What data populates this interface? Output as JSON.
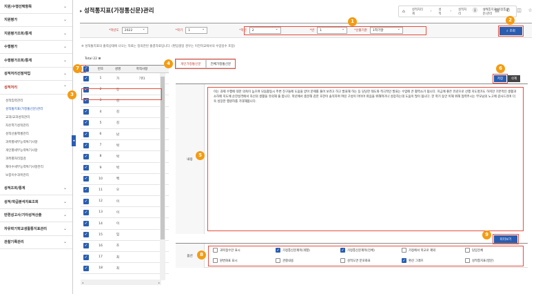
{
  "sidebar": {
    "items_top": [
      {
        "label": "지원/수행선택항목"
      },
      {
        "label": "지원평가"
      },
      {
        "label": "지원평가조회/통계"
      },
      {
        "label": "수행평가"
      },
      {
        "label": "수행평가조회/통계"
      },
      {
        "label": "성적처리선정작업"
      }
    ],
    "open_menu": "성적처리",
    "sub_items": [
      {
        "label": "성적입력관리",
        "active": false
      },
      {
        "label": "성적통지표(가정통신문)관리",
        "active": true
      },
      {
        "label": "교과/교과성적관리",
        "active": false
      },
      {
        "label": "자유학기성적관리",
        "active": false
      },
      {
        "label": "성적산출엑셀관리",
        "active": false
      },
      {
        "label": "과목별세부능력특기사항",
        "active": false
      },
      {
        "label": "개인별세부능력특기사항",
        "active": false
      },
      {
        "label": "과목별처리점검",
        "active": false
      },
      {
        "label": "재이수세부능력특기사항관리",
        "active": false
      },
      {
        "label": "보충이수과목관리",
        "active": false
      }
    ],
    "items_bottom": [
      {
        "label": "성적조회/통계"
      },
      {
        "label": "성적/학급분석자료조회"
      },
      {
        "label": "반편성고사/기타성적산출"
      },
      {
        "label": "자유학기학교생활통지표관리"
      },
      {
        "label": "관찰기록관리"
      }
    ]
  },
  "header": {
    "title": "성적통지표(가정통신문)관리",
    "breadcrumb": [
      "성적처리계",
      "성적",
      "성적처리",
      "성적통지표(가정통신문)관리"
    ]
  },
  "filters": {
    "year_label": "*학년도",
    "year_value": "2022",
    "term_label": "*학기",
    "term_value": "1",
    "grade_label": "*학년",
    "grade_value": "2",
    "class_label": "*반",
    "class_value": "1",
    "basis_label": "*산출기준",
    "basis_value": "1학기말",
    "search_label": "조회"
  },
  "notice": "※ 성적통지표의 출력상태에 나오는 자료는 정의관된 출결자료입니다. (편입생일 경우는 이전학교에서의 수업일수 포함)",
  "student_table": {
    "total_label": "Total 22",
    "headers": [
      "번호",
      "성명",
      "학적사항"
    ],
    "rows": [
      {
        "no": "1",
        "name": "가",
        "note": "기타"
      },
      {
        "no": "2",
        "name": "강",
        "note": ""
      },
      {
        "no": "3",
        "name": "김",
        "note": ""
      },
      {
        "no": "4",
        "name": "김",
        "note": ""
      },
      {
        "no": "5",
        "name": "김",
        "note": ""
      },
      {
        "no": "6",
        "name": "남",
        "note": ""
      },
      {
        "no": "7",
        "name": "박",
        "note": ""
      },
      {
        "no": "8",
        "name": "박",
        "note": ""
      },
      {
        "no": "9",
        "name": "박",
        "note": ""
      },
      {
        "no": "10",
        "name": "백",
        "note": ""
      },
      {
        "no": "11",
        "name": "오",
        "note": ""
      },
      {
        "no": "12",
        "name": "이",
        "note": ""
      },
      {
        "no": "13",
        "name": "이",
        "note": ""
      },
      {
        "no": "14",
        "name": "이",
        "note": ""
      },
      {
        "no": "15",
        "name": "임",
        "note": ""
      },
      {
        "no": "16",
        "name": "조",
        "note": ""
      },
      {
        "no": "17",
        "name": "최",
        "note": ""
      },
      {
        "no": "18",
        "name": "최",
        "note": ""
      }
    ]
  },
  "tabs": [
    {
      "label": "개인가정통신문",
      "active": true
    },
    {
      "label": "전체가정통신문",
      "active": false
    }
  ],
  "actions": {
    "save": "저장",
    "delete": "삭제",
    "preview": "미리보기"
  },
  "content": {
    "label": "내용",
    "text": "이는 과제 수행에 대한 의욕이 높으며 모둠활동시 주변 친구들에 도움을 받아 문제를 풀어 보려고 하고 발표해 하는 등 당당한 태도와 적극적인 발표는 수업에 큰 활력소가 됩니다. 지금에 좋은 유년으로 선행 지도명가도 하지만 기본적인 생활과 소하에 지도에 순한성격에서 자신의 생활을 유의해 줄 합니다. 학년에서 충분해 감한 호한이 솔직하며 여린 구성이 마이어 따음을 위해여거나 성장하는데 도움이 많이 됩니다. 한 학기 동안 이해 위해 협력주시는 부모님의 노고에 감사드리며 더욱 성장한 행원하를 기대해봅니다."
  },
  "options": {
    "label": "옵션",
    "items": [
      {
        "label": "과목점수만 표시",
        "checked": false
      },
      {
        "label": "가정통신문제목(개별)",
        "checked": true
      },
      {
        "label": "가정통신문제목(전체)",
        "checked": true
      },
      {
        "label": "가정에서 학교로 제외",
        "checked": false
      },
      {
        "label": "담임전체",
        "checked": false
      },
      {
        "label": "원변화표 표시",
        "checked": false
      },
      {
        "label": "관찰내용",
        "checked": false
      },
      {
        "label": "성적도면 분포화표",
        "checked": false
      },
      {
        "label": "환산 그래프",
        "checked": true
      },
      {
        "label": "성적통지표(영문)",
        "checked": false
      }
    ]
  },
  "annotations": [
    "1",
    "2",
    "3",
    "4",
    "5",
    "6",
    "7",
    "8",
    "9"
  ],
  "colors": {
    "accent": "#2a5db0",
    "highlight": "#e74c3c",
    "badge": "#f39c12"
  }
}
